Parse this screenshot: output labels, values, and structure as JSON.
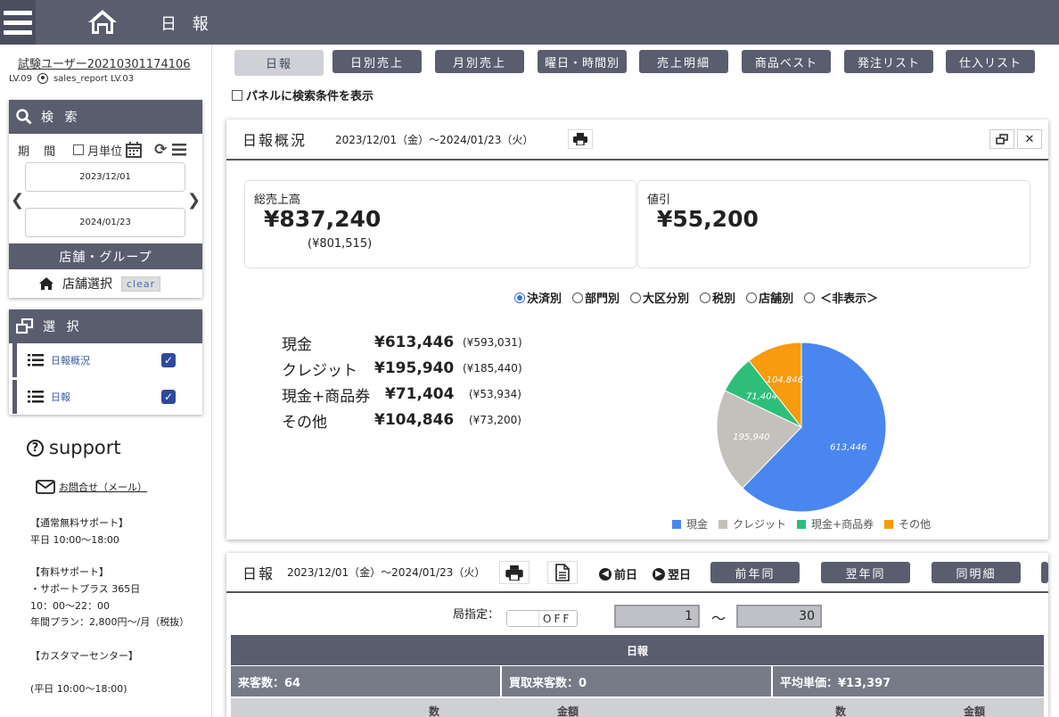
{
  "header": {
    "title": "日 報",
    "menu_icon": "hamburger-icon",
    "home_icon": "home-icon"
  },
  "sidebar": {
    "user_name": "試験ユーザー20210301174106",
    "level": "LV.09",
    "report_user": "sales_report LV.03",
    "search": {
      "title": "検 索",
      "period_label": "期 間",
      "monthly_label": "月単位",
      "date_from": "2023/12/01",
      "date_to": "2024/01/23",
      "store_group": "店舗・グループ",
      "store_select": "店舗選択",
      "clear": "clear"
    },
    "select": {
      "title": "選 択",
      "items": [
        {
          "label": "日報概況",
          "checked": true
        },
        {
          "label": "日報",
          "checked": true
        }
      ]
    },
    "support": {
      "title": "support",
      "mail_link": "お問合せ（メール）",
      "lines": [
        "【通常無料サポート】",
        "平日 10:00～18:00",
        "【有料サポート】",
        "・サポートプラス 365日",
        " 10：00～22：00",
        "年間プラン：2,800円～/月（税抜）",
        "【カスタマーセンター】",
        "(平日 10:00～18:00)"
      ]
    }
  },
  "tabs": [
    "日報",
    "日別売上",
    "月別売上",
    "曜日・時間別",
    "売上明細",
    "商品ベスト",
    "発注リスト",
    "仕入リスト"
  ],
  "panel_condition": "パネルに検索条件を表示",
  "overview": {
    "title": "日報概況",
    "date_range": "2023/12/01（金）～2024/01/23（火）",
    "total_label": "総売上高",
    "total_value": "¥837,240",
    "total_prev": "(¥801,515)",
    "discount_label": "値引",
    "discount_value": "¥55,200",
    "radios": [
      {
        "label": "決済別",
        "checked": true
      },
      {
        "label": "部門別",
        "checked": false
      },
      {
        "label": "大区分別",
        "checked": false
      },
      {
        "label": "税別",
        "checked": false
      },
      {
        "label": "店舗別",
        "checked": false
      },
      {
        "label": "＜非表示＞",
        "checked": false
      }
    ],
    "payments": [
      {
        "name": "現金",
        "amount": "¥613,446",
        "prev": "(¥593,031)"
      },
      {
        "name": "クレジット",
        "amount": "¥195,940",
        "prev": "(¥185,440)"
      },
      {
        "name": "現金+商品券",
        "amount": "¥71,404",
        "prev": "(¥53,934)"
      },
      {
        "name": "その他",
        "amount": "¥104,846",
        "prev": "(¥73,200)"
      }
    ]
  },
  "chart_data": {
    "type": "pie",
    "categories": [
      "現金",
      "クレジット",
      "現金+商品券",
      "その他"
    ],
    "values": [
      613446,
      195940,
      71404,
      104846
    ],
    "labels": [
      "613,446",
      "195,940",
      "71,404",
      "104,846"
    ],
    "colors": [
      "#4a86f0",
      "#c4c1bd",
      "#2dbf7a",
      "#f89b0e"
    ],
    "legend": "bottom"
  },
  "daily": {
    "title": "日報",
    "date_range": "2023/12/01（金）～2024/01/23（火）",
    "prev_day": "前日",
    "next_day": "翌日",
    "buttons": [
      "前年同",
      "翌年同",
      "同明細"
    ],
    "bureau_label": "局指定：",
    "toggle": "OFF",
    "range_from": "1",
    "range_to": "30",
    "tilde": "～",
    "table_title": "日報",
    "cells": [
      "来客数：64",
      "買取来客数：0",
      "平均単価：¥13,397"
    ],
    "sub_headers": [
      "数",
      "金額",
      "数",
      "金額"
    ]
  }
}
